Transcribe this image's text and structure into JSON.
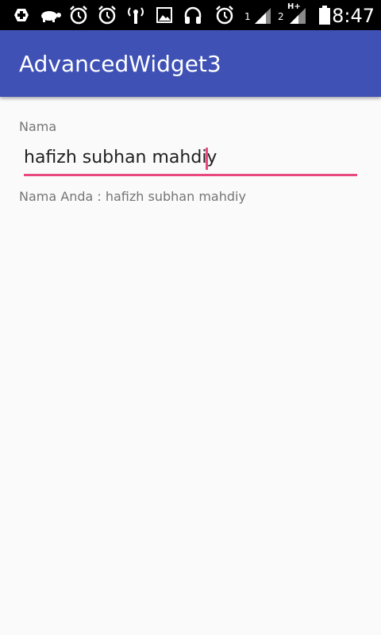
{
  "status_bar": {
    "icons": [
      "add-icon",
      "turtle-icon",
      "alarm-icon",
      "alarm-icon",
      "wireless-signal-icon",
      "image-icon",
      "headphones-icon",
      "alarm-icon",
      "signal-icon",
      "signal-icon",
      "battery-icon"
    ],
    "sim1_label": "1",
    "sim2_label": "2",
    "network_type": "H+",
    "time": "8:47"
  },
  "app_bar": {
    "title": "AdvancedWidget3",
    "background": "#3f51b5"
  },
  "form": {
    "name_label": "Nama",
    "name_value": "hafizh subhan mahdiy",
    "accent_color": "#e8477f",
    "result_text": "Nama Anda : hafizh subhan mahdiy"
  }
}
